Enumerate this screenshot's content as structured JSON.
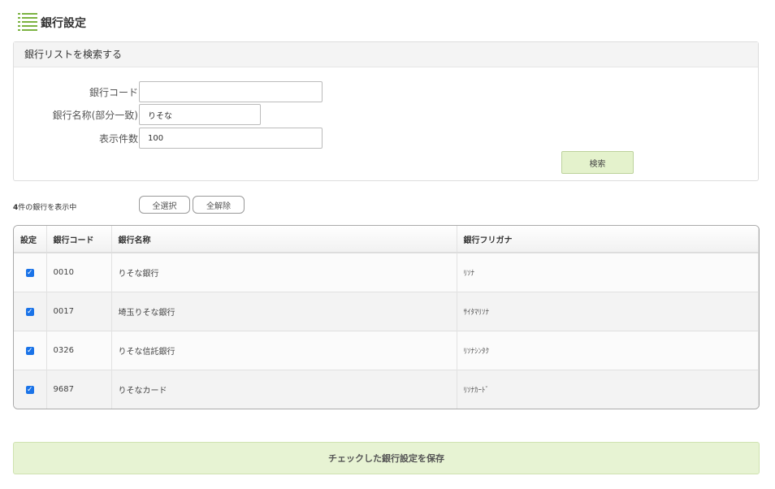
{
  "header": {
    "title": "銀行設定",
    "icon": "list-icon"
  },
  "search": {
    "panel_title": "銀行リストを検索する",
    "bank_code_label": "銀行コード",
    "bank_code_value": "",
    "bank_name_label": "銀行名称(部分一致)",
    "bank_name_value": "りそな",
    "count_label": "表示件数",
    "count_value": "100",
    "search_button": "検索"
  },
  "results": {
    "count_number": "4",
    "count_suffix": "件の銀行を表示中",
    "select_all": "全選択",
    "deselect_all": "全解除"
  },
  "table": {
    "columns": [
      "設定",
      "銀行コード",
      "銀行名称",
      "銀行フリガナ"
    ],
    "rows": [
      {
        "checked": true,
        "code": "0010",
        "name": "りそな銀行",
        "kana": "ﾘｿﾅ"
      },
      {
        "checked": true,
        "code": "0017",
        "name": "埼玉りそな銀行",
        "kana": "ｻｲﾀﾏﾘｿﾅ"
      },
      {
        "checked": true,
        "code": "0326",
        "name": "りそな信託銀行",
        "kana": "ﾘｿﾅｼﾝﾀｸ"
      },
      {
        "checked": true,
        "code": "9687",
        "name": "りそなカード",
        "kana": "ﾘｿﾅｶｰﾄﾞ"
      }
    ]
  },
  "footer": {
    "save_button": "チェックした銀行設定を保存"
  },
  "colors": {
    "accent_green": "#e4f2cc",
    "checkbox_blue": "#1a73e8",
    "icon_green": "#7cb342"
  }
}
